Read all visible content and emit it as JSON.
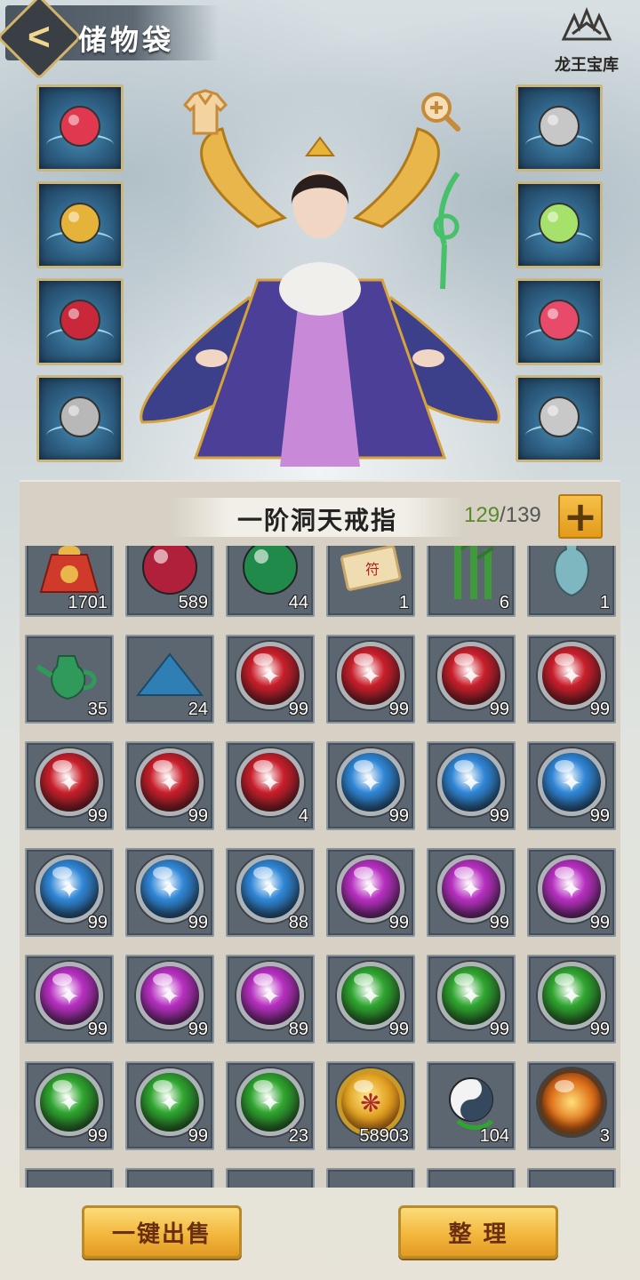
{
  "header": {
    "title": "储物袋",
    "brand_name": "龙王宝库"
  },
  "equipment": {
    "left": [
      {
        "name": "sword",
        "color": "#e0384f"
      },
      {
        "name": "helmet",
        "color": "#e6b33a"
      },
      {
        "name": "armor",
        "color": "#c8283a"
      },
      {
        "name": "bracer",
        "color": "#b8b8b8"
      }
    ],
    "right": [
      {
        "name": "ring-amber",
        "color": "#c7c7c7"
      },
      {
        "name": "jade-pendant",
        "color": "#a6e26b"
      },
      {
        "name": "bracelet",
        "color": "#e84a6a"
      },
      {
        "name": "shield",
        "color": "#c8c8c8"
      }
    ]
  },
  "inventory": {
    "ring_name": "一阶洞天戒指",
    "capacity_used": "129",
    "capacity_separator": "/",
    "capacity_total": "139",
    "items": [
      {
        "kind": "pouch",
        "color": "#d03a2a",
        "qty": "1701"
      },
      {
        "kind": "ball",
        "color": "#b0203a",
        "qty": "589"
      },
      {
        "kind": "ball",
        "color": "#1f8a4a",
        "qty": "44"
      },
      {
        "kind": "scroll",
        "color": "#c9a86a",
        "qty": "1"
      },
      {
        "kind": "bamboo",
        "color": "#3f9a3a",
        "qty": "6"
      },
      {
        "kind": "vase",
        "color": "#7fb7c0",
        "qty": "1"
      },
      {
        "kind": "teapot",
        "color": "#2f9a5a",
        "qty": "35"
      },
      {
        "kind": "powder",
        "color": "#2f7fb5",
        "qty": "24"
      },
      {
        "kind": "orb",
        "color": "#c81e2a",
        "qty": "99"
      },
      {
        "kind": "orb",
        "color": "#c81e2a",
        "qty": "99"
      },
      {
        "kind": "orb",
        "color": "#c81e2a",
        "qty": "99"
      },
      {
        "kind": "orb",
        "color": "#c81e2a",
        "qty": "99"
      },
      {
        "kind": "orb",
        "color": "#c81e2a",
        "qty": "99"
      },
      {
        "kind": "orb",
        "color": "#c81e2a",
        "qty": "99"
      },
      {
        "kind": "orb",
        "color": "#c81e2a",
        "qty": "4"
      },
      {
        "kind": "orb",
        "color": "#2f86d6",
        "qty": "99"
      },
      {
        "kind": "orb",
        "color": "#2f86d6",
        "qty": "99"
      },
      {
        "kind": "orb",
        "color": "#2f86d6",
        "qty": "99"
      },
      {
        "kind": "orb",
        "color": "#2f86d6",
        "qty": "99"
      },
      {
        "kind": "orb",
        "color": "#2f86d6",
        "qty": "99"
      },
      {
        "kind": "orb",
        "color": "#2f86d6",
        "qty": "88"
      },
      {
        "kind": "orb",
        "color": "#b62fc0",
        "qty": "99"
      },
      {
        "kind": "orb",
        "color": "#b62fc0",
        "qty": "99"
      },
      {
        "kind": "orb",
        "color": "#b62fc0",
        "qty": "99"
      },
      {
        "kind": "orb",
        "color": "#b62fc0",
        "qty": "99"
      },
      {
        "kind": "orb",
        "color": "#b62fc0",
        "qty": "99"
      },
      {
        "kind": "orb",
        "color": "#b62fc0",
        "qty": "89"
      },
      {
        "kind": "orb",
        "color": "#2ea52e",
        "qty": "99"
      },
      {
        "kind": "orb",
        "color": "#2ea52e",
        "qty": "99"
      },
      {
        "kind": "orb",
        "color": "#2ea52e",
        "qty": "99"
      },
      {
        "kind": "orb",
        "color": "#2ea52e",
        "qty": "99"
      },
      {
        "kind": "orb",
        "color": "#2ea52e",
        "qty": "99"
      },
      {
        "kind": "orb",
        "color": "#2ea52e",
        "qty": "23"
      },
      {
        "kind": "gold-orb",
        "color": "#e0a020",
        "qty": "58903"
      },
      {
        "kind": "yinyang",
        "color": "#34495e",
        "qty": "104"
      },
      {
        "kind": "fire-orb",
        "color": "#e0731c",
        "qty": "3"
      },
      {
        "kind": "partial",
        "color": "#4a6a8a",
        "qty": ""
      },
      {
        "kind": "partial",
        "color": "#3f6a7a",
        "qty": ""
      },
      {
        "kind": "partial",
        "color": "#3a5a7a",
        "qty": ""
      },
      {
        "kind": "partial",
        "color": "#6a4a3a",
        "qty": ""
      },
      {
        "kind": "partial",
        "color": "#c0642a",
        "qty": ""
      },
      {
        "kind": "partial",
        "color": "#7a5a4a",
        "qty": ""
      }
    ]
  },
  "actions": {
    "sell_all_label": "一键出售",
    "sort_label": "整 理"
  }
}
